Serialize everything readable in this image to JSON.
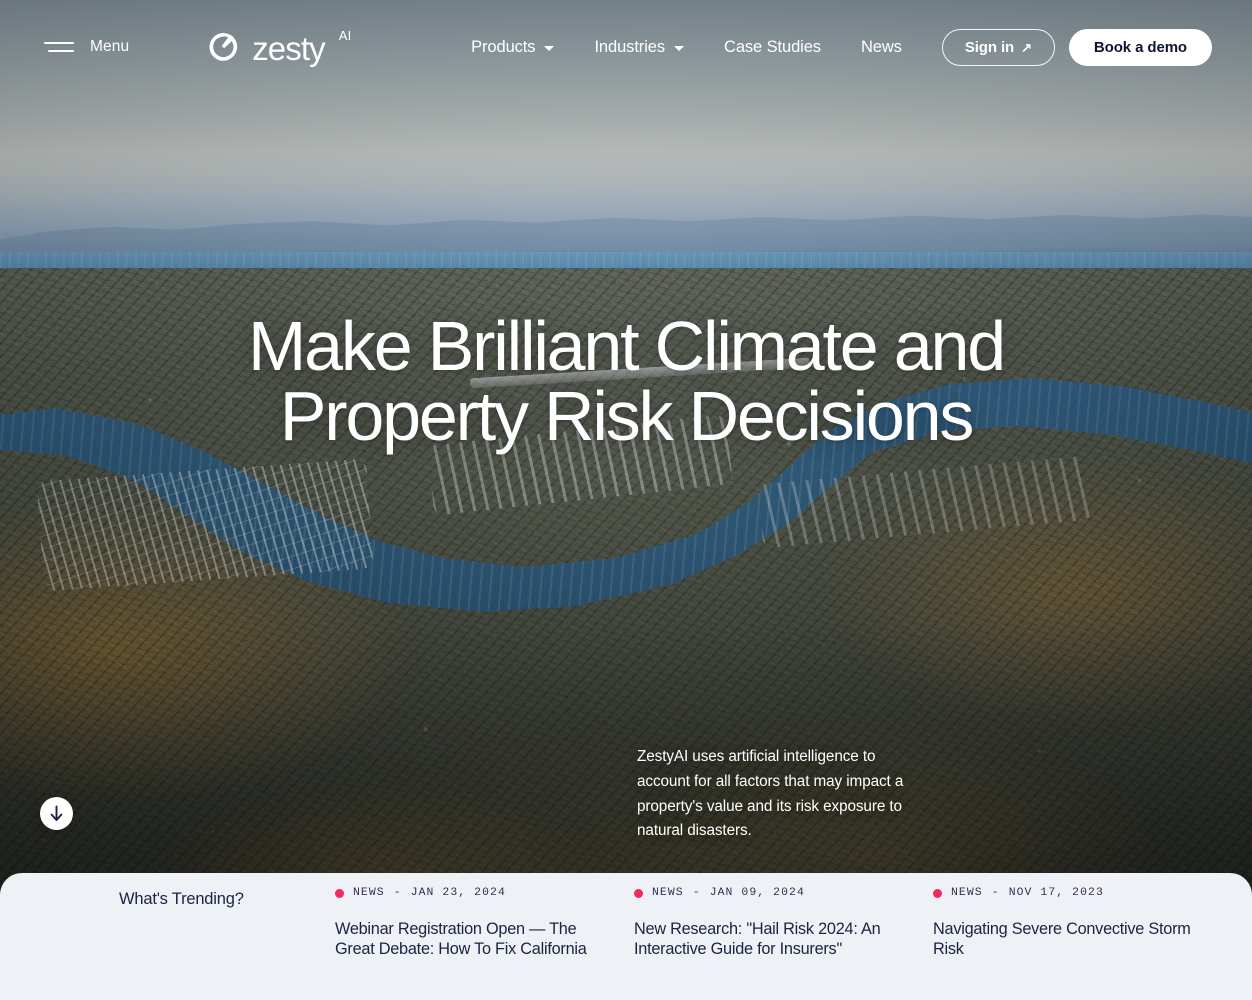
{
  "nav": {
    "menu_label": "Menu",
    "brand_word": "zesty",
    "brand_sup": "AI",
    "links": [
      {
        "label": "Products",
        "has_caret": true
      },
      {
        "label": "Industries",
        "has_caret": true
      },
      {
        "label": "Case Studies",
        "has_caret": false
      },
      {
        "label": "News",
        "has_caret": false
      }
    ],
    "signin_label": "Sign in",
    "signin_arrow": "↗",
    "demo_label": "Book a demo"
  },
  "hero": {
    "title_line1": "Make Brilliant Climate and",
    "title_line2": "Property Risk Decisions",
    "description": "ZestyAI uses artificial intelligence to account for all factors that may impact a property's value and its risk exposure to natural disasters.",
    "scroll_icon": "arrow-down-icon"
  },
  "trending": {
    "title": "What's Trending?",
    "accent_color": "#F4275F",
    "panel_color": "#EEF1F5",
    "text_color": "#1B2342",
    "items": [
      {
        "category": "NEWS",
        "separator": "-",
        "date": "JAN 23, 2024",
        "headline": "Webinar Registration Open — The Great Debate: How To Fix California"
      },
      {
        "category": "NEWS",
        "separator": "-",
        "date": "JAN 09, 2024",
        "headline": "New Research: \"Hail Risk 2024: An Interactive Guide for Insurers\""
      },
      {
        "category": "NEWS",
        "separator": "-",
        "date": "NOV 17, 2023",
        "headline": "Navigating Severe Convective Storm Risk"
      }
    ]
  }
}
